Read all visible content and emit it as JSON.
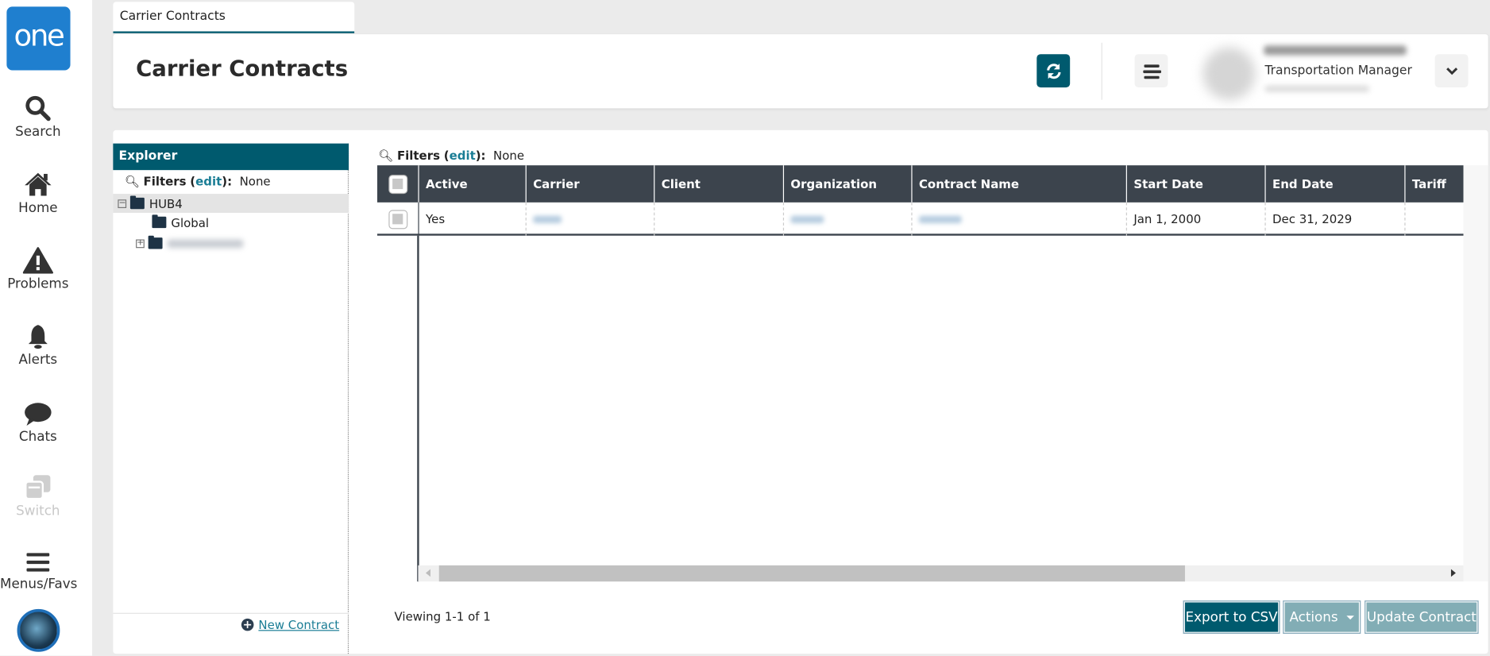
{
  "nav": {
    "logo": "one",
    "items": [
      {
        "label": "Search",
        "icon": "search-icon"
      },
      {
        "label": "Home",
        "icon": "home-icon"
      },
      {
        "label": "Problems",
        "icon": "warning-icon"
      },
      {
        "label": "Alerts",
        "icon": "bell-icon"
      },
      {
        "label": "Chats",
        "icon": "chat-icon"
      },
      {
        "label": "Switch",
        "icon": "switch-icon"
      },
      {
        "label": "Menus/Favs",
        "icon": "menu-icon"
      }
    ]
  },
  "tab": {
    "label": "Carrier Contracts"
  },
  "header": {
    "title": "Carrier Contracts",
    "user_role": "Transportation Manager"
  },
  "explorer": {
    "title": "Explorer",
    "filters_label": "Filters",
    "edit_label": "edit",
    "filters_value": "None",
    "tree": [
      {
        "label": "HUB4"
      },
      {
        "label": "Global"
      }
    ],
    "new_contract": "New Contract"
  },
  "grid": {
    "filters_label": "Filters",
    "edit_label": "edit",
    "filters_value": "None",
    "columns": [
      "Active",
      "Carrier",
      "Client",
      "Organization",
      "Contract Name",
      "Start Date",
      "End Date",
      "Tariff"
    ],
    "rows": [
      {
        "active": "Yes",
        "start_date": "Jan 1, 2000",
        "end_date": "Dec 31, 2029"
      }
    ],
    "viewing": "Viewing 1-1 of 1"
  },
  "buttons": {
    "export": "Export to CSV",
    "actions": "Actions",
    "update": "Update Contract"
  },
  "colors": {
    "brand": "#005a6e",
    "logo": "#1f7fcf",
    "header_dark": "#3c444d",
    "disabled_btn": "#82adb5"
  }
}
